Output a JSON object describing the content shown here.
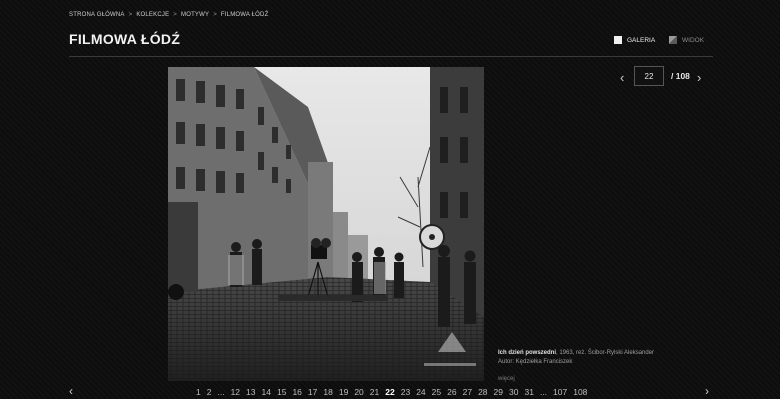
{
  "breadcrumb": {
    "items": [
      "STRONA GŁÓWNA",
      "KOLEKCJE",
      "MOTYWY",
      "FILMOWA ŁÓDŹ"
    ],
    "separator": ">"
  },
  "header": {
    "title": "FILMOWA ŁÓDŹ",
    "views": {
      "gallery_label": "GALERIA",
      "view_label": "WIDOK"
    }
  },
  "pager": {
    "current": "22",
    "total": "/ 108",
    "prev_icon": "chevron-left-icon",
    "next_icon": "chevron-right-icon"
  },
  "caption": {
    "title": "Ich dzień powszedni",
    "details": ", 1963, reż. Ścibor-Rylski Aleksander",
    "author": "Autor: Kędziełka Franciszek",
    "more": "więcej"
  },
  "pagination": {
    "pages": [
      "1",
      "2",
      "...",
      "12",
      "13",
      "14",
      "15",
      "16",
      "17",
      "18",
      "19",
      "20",
      "21",
      "22",
      "23",
      "24",
      "25",
      "26",
      "27",
      "28",
      "29",
      "30",
      "31",
      "...",
      "107",
      "108"
    ],
    "current_index": 13
  },
  "colors": {
    "background": "#0d0d0d",
    "text": "#d8d8d8",
    "accent": "#ffffff"
  }
}
